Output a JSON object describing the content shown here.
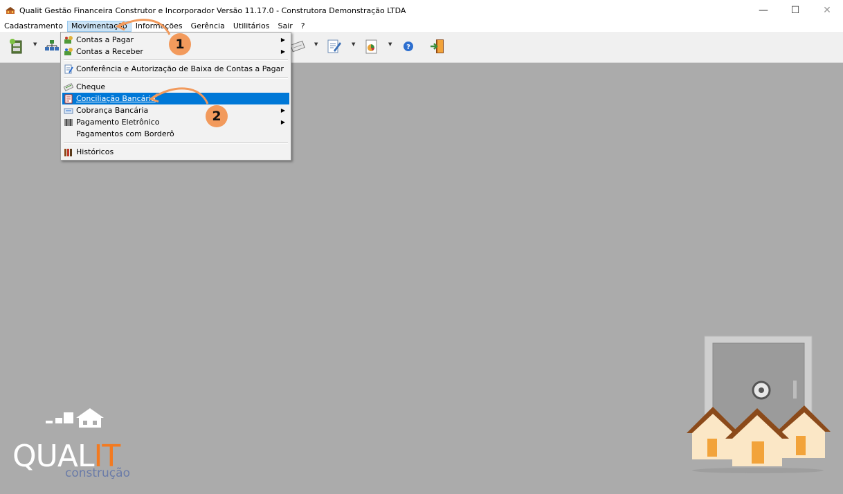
{
  "window": {
    "title": "Qualit Gestão Financeira Construtor e Incorporador Versão 11.17.0 - Construtora Demonstração LTDA",
    "controls": {
      "minimize": "—",
      "maximize": "☐",
      "close": "✕"
    }
  },
  "menubar": {
    "items": [
      {
        "label": "Cadastramento"
      },
      {
        "label": "Movimentação"
      },
      {
        "label": "Informações"
      },
      {
        "label": "Gerência"
      },
      {
        "label": "Utilitários"
      },
      {
        "label": "Sair"
      },
      {
        "label": "?"
      }
    ]
  },
  "dropdown": {
    "items": [
      {
        "label": "Contas a Pagar",
        "icon": "money-icon",
        "submenu": true
      },
      {
        "label": "Contas a Receber",
        "icon": "money-icon",
        "submenu": true
      },
      {
        "label": "Conferência e Autorização de Baixa de Contas a Pagar",
        "icon": "check-document-icon",
        "submenu": false
      },
      {
        "label": "Cheque",
        "icon": "cheque-icon",
        "submenu": false
      },
      {
        "label": "Conciliação Bancária",
        "icon": "reconciliation-icon",
        "submenu": false,
        "highlighted": true
      },
      {
        "label": "Cobrança Bancária",
        "icon": "bank-billing-icon",
        "submenu": true
      },
      {
        "label": "Pagamento Eletrônico",
        "icon": "barcode-icon",
        "submenu": true
      },
      {
        "label": "Pagamentos com Borderô",
        "icon": "",
        "submenu": false
      },
      {
        "label": "Históricos",
        "icon": "books-icon",
        "submenu": false
      }
    ],
    "submenu_arrow": "▶"
  },
  "callouts": {
    "step1": "1",
    "step2": "2"
  },
  "logo": {
    "text_a": "QUAL",
    "text_b": "IT",
    "subtitle": "construção"
  },
  "colors": {
    "accent": "#0078d7",
    "badge": "#f29a5c",
    "workspace": "#ababab",
    "logo_orange": "#f37a20"
  }
}
